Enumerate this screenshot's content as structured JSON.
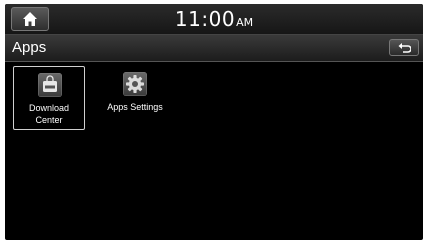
{
  "status_bar": {
    "home_icon": "home-icon",
    "time": "11:00",
    "ampm": "AM"
  },
  "header": {
    "title": "Apps",
    "back_icon": "back-arrow-icon"
  },
  "apps": [
    {
      "label_line1": "Download",
      "label_line2": "Center",
      "icon": "shopping-bag-app-icon",
      "selected": true
    },
    {
      "label_line1": "Apps Settings",
      "label_line2": "",
      "icon": "gear-icon",
      "selected": false
    }
  ],
  "colors": {
    "background": "#000000",
    "text": "#ffffff",
    "selection_border": "#d0d0d0"
  }
}
